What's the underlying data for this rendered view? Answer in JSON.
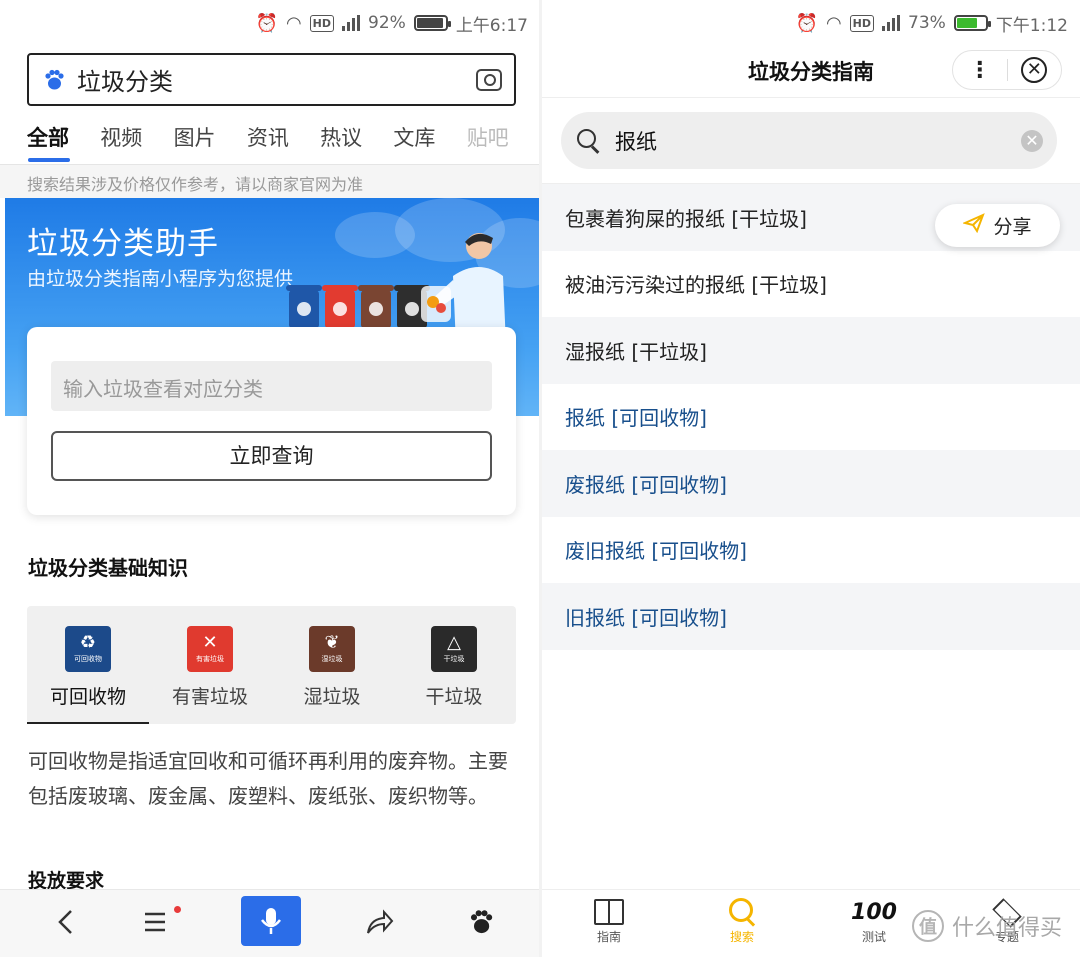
{
  "left": {
    "status": {
      "percent": "92%",
      "time": "上午6:17",
      "battery_level": 0.92
    },
    "search": {
      "query": "垃圾分类"
    },
    "tabs": [
      "全部",
      "视频",
      "图片",
      "资讯",
      "热议",
      "文库",
      "贴吧"
    ],
    "hint": "搜索结果涉及价格仅作参考，请以商家官网为准",
    "banner": {
      "title": "垃圾分类助手",
      "subtitle": "由垃圾分类指南小程序为您提供"
    },
    "card": {
      "placeholder": "输入垃圾查看对应分类",
      "button": "立即查询"
    },
    "section_title": "垃圾分类基础知识",
    "categories": [
      {
        "label": "可回收物",
        "icon_text": "可回收物",
        "color": "#1c4a8a"
      },
      {
        "label": "有害垃圾",
        "icon_text": "有害垃圾",
        "color": "#e03a2f"
      },
      {
        "label": "湿垃圾",
        "icon_text": "湿垃圾",
        "color": "#6b3a2a"
      },
      {
        "label": "干垃圾",
        "icon_text": "干垃圾",
        "color": "#2a2a2a"
      }
    ],
    "description": "可回收物是指适宜回收和可循环再利用的废弃物。主要包括废玻璃、废金属、废塑料、废纸张、废织物等。",
    "subsection_title": "投放要求"
  },
  "right": {
    "status": {
      "percent": "73%",
      "time": "下午1:12",
      "battery_level": 0.73
    },
    "title": "垃圾分类指南",
    "search": {
      "query": "报纸"
    },
    "results": [
      {
        "text": "包裹着狗屎的报纸 [干垃圾]",
        "type": "dry"
      },
      {
        "text": "被油污污染过的报纸 [干垃圾]",
        "type": "dry"
      },
      {
        "text": "湿报纸 [干垃圾]",
        "type": "dry"
      },
      {
        "text": "报纸 [可回收物]",
        "type": "recyclable"
      },
      {
        "text": "废报纸 [可回收物]",
        "type": "recyclable"
      },
      {
        "text": "废旧报纸 [可回收物]",
        "type": "recyclable"
      },
      {
        "text": "旧报纸 [可回收物]",
        "type": "recyclable"
      }
    ],
    "share_label": "分享",
    "bottom_nav": [
      {
        "label": "指南",
        "icon": "book-icon"
      },
      {
        "label": "搜索",
        "icon": "search-icon"
      },
      {
        "label": "测试",
        "icon": "hundred-icon",
        "icon_text": "100"
      },
      {
        "label": "专题",
        "icon": "layers-icon"
      }
    ]
  },
  "watermark": {
    "text": "什么值得买",
    "icon_text": "值"
  },
  "colors": {
    "baidu_blue": "#2b6de8",
    "accent_yellow": "#f5b500",
    "recyclable_text": "#184f8c"
  }
}
